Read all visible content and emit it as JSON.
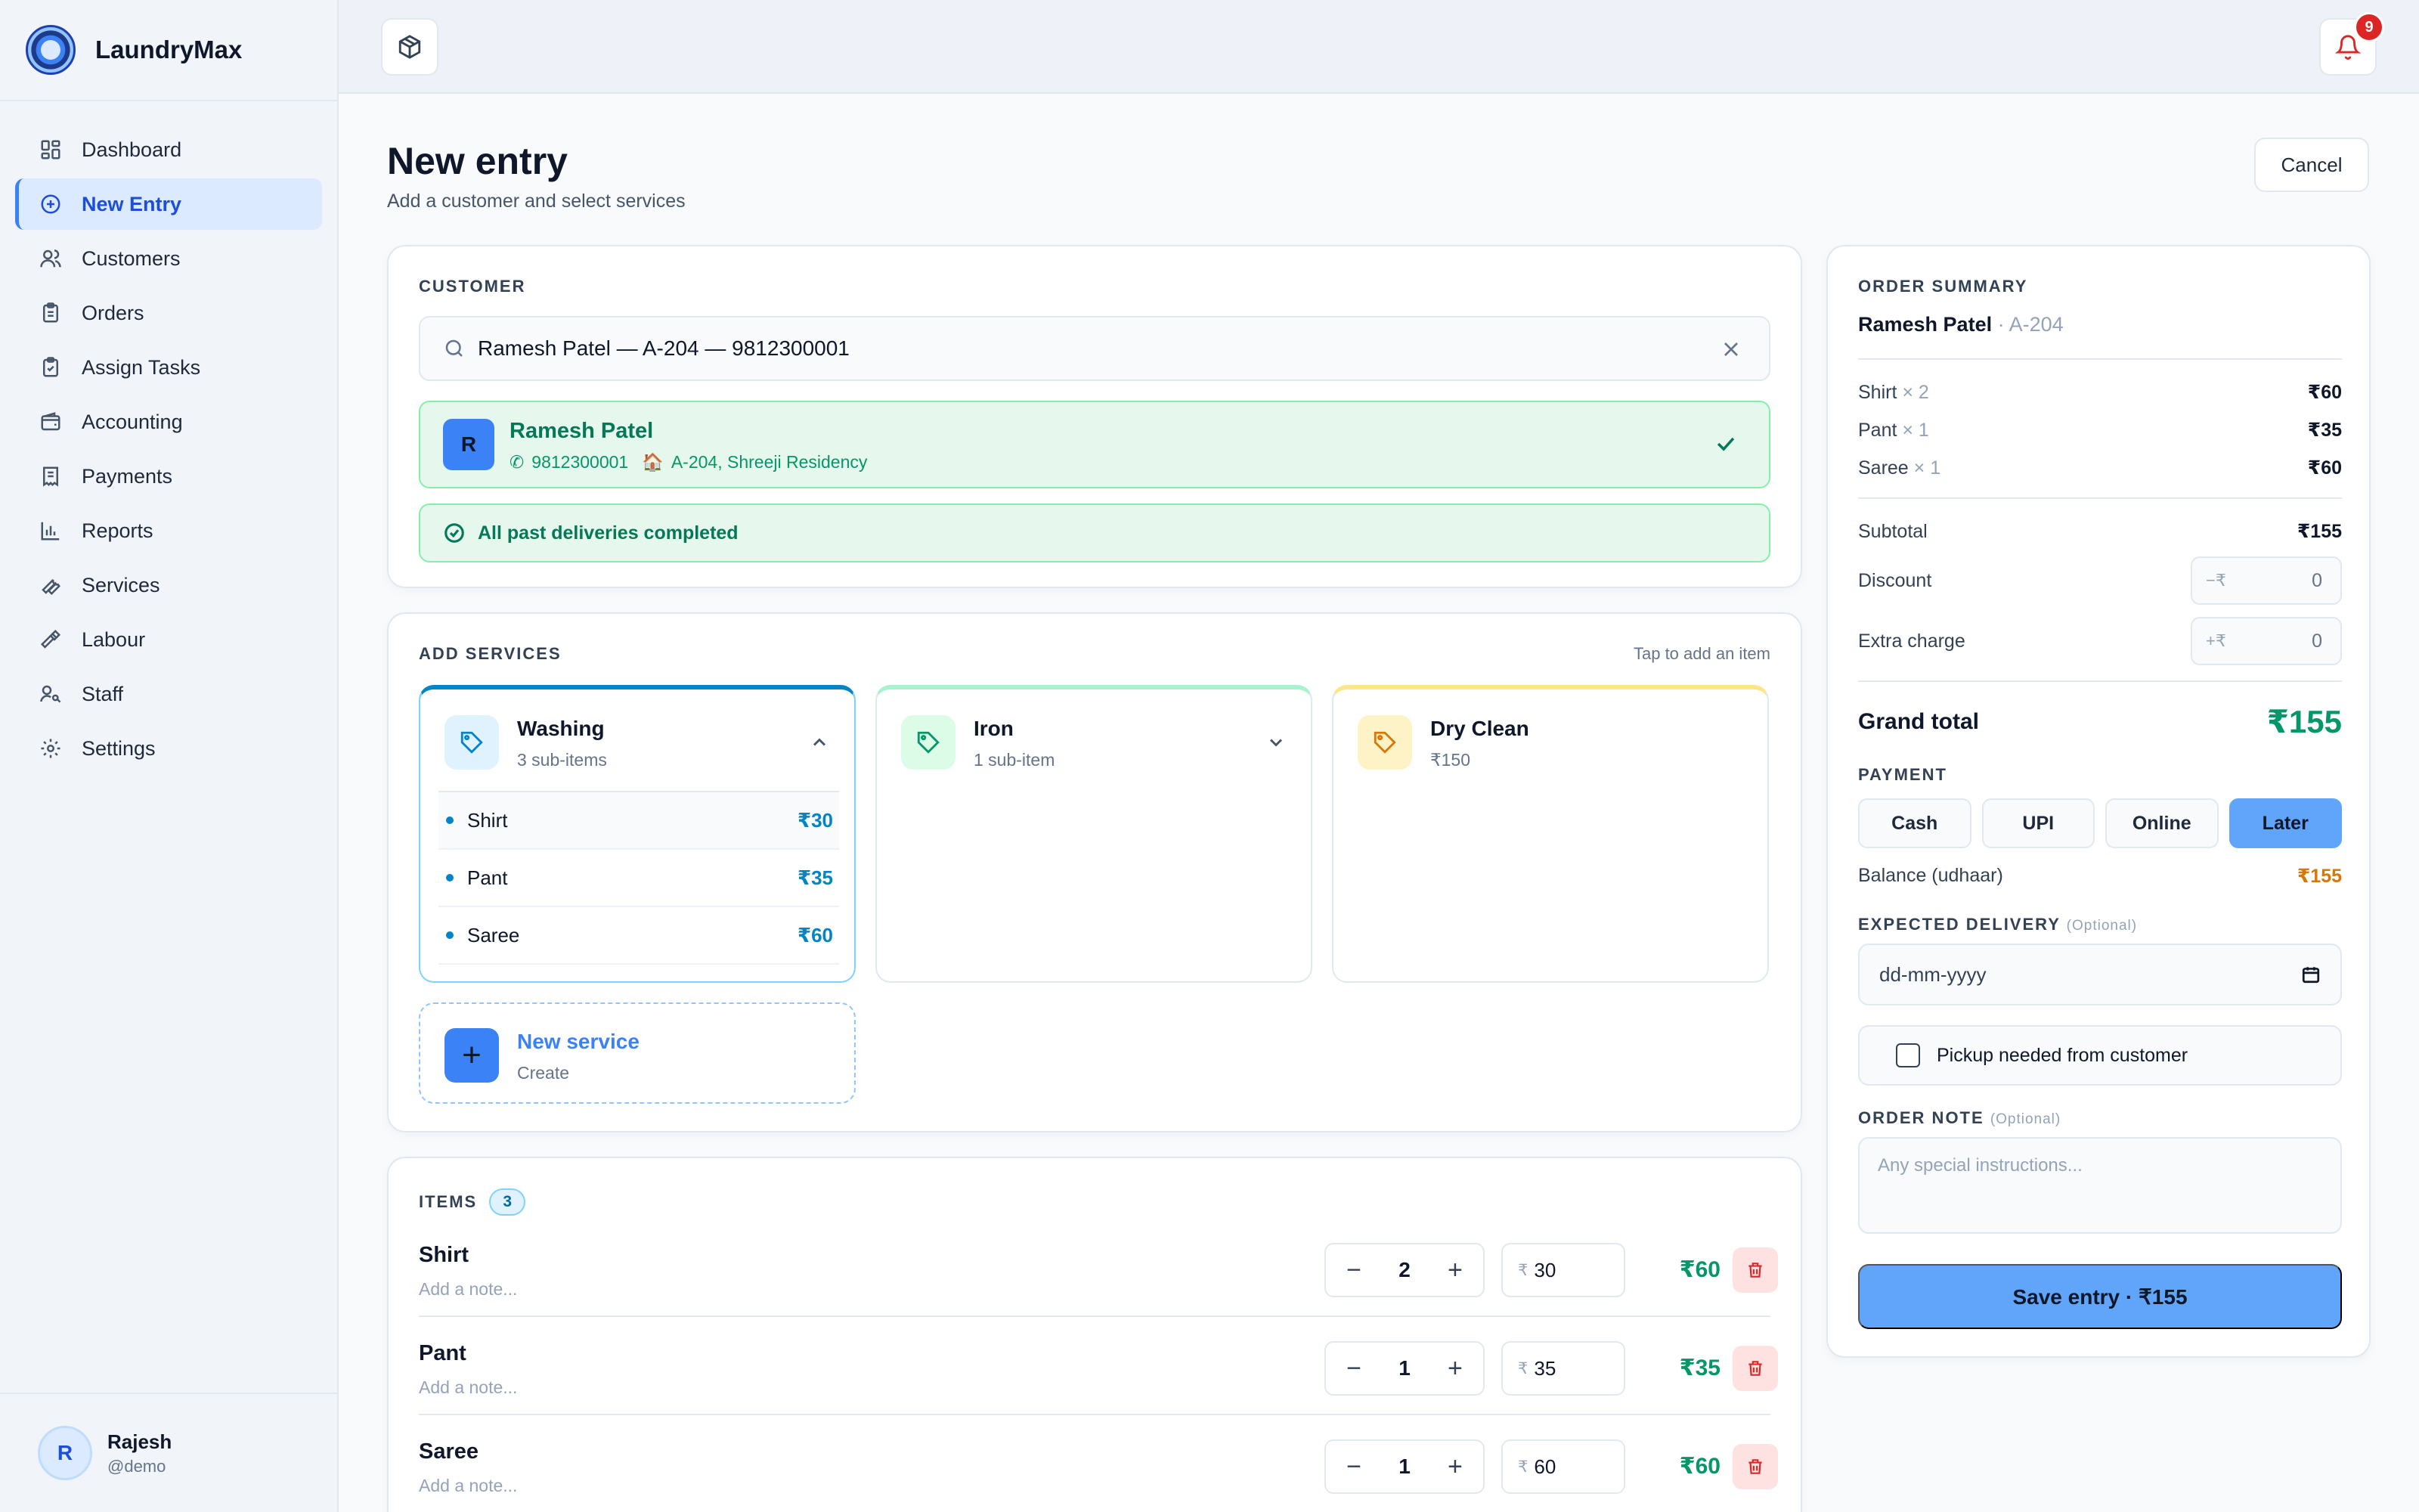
{
  "app": {
    "name": "LaundryMax"
  },
  "sidebar": {
    "items": [
      {
        "label": "Dashboard",
        "icon": "dashboard-icon"
      },
      {
        "label": "New Entry",
        "icon": "plus-circle-icon",
        "active": true
      },
      {
        "label": "Customers",
        "icon": "users-icon"
      },
      {
        "label": "Orders",
        "icon": "clipboard-icon"
      },
      {
        "label": "Assign Tasks",
        "icon": "clipboard-check-icon"
      },
      {
        "label": "Accounting",
        "icon": "wallet-icon"
      },
      {
        "label": "Payments",
        "icon": "receipt-icon"
      },
      {
        "label": "Reports",
        "icon": "bar-chart-icon"
      },
      {
        "label": "Services",
        "icon": "wrench-icon"
      },
      {
        "label": "Labour",
        "icon": "hammer-icon"
      },
      {
        "label": "Staff",
        "icon": "user-key-icon"
      },
      {
        "label": "Settings",
        "icon": "gear-icon"
      }
    ],
    "user": {
      "initial": "R",
      "name": "Rajesh",
      "handle": "@demo"
    }
  },
  "topbar": {
    "notification_count": "9"
  },
  "header": {
    "title": "New entry",
    "subtitle": "Add a customer and select services",
    "cancel_label": "Cancel"
  },
  "customer": {
    "section_label": "CUSTOMER",
    "search_value": "Ramesh Patel — A-204 — 9812300001",
    "selected": {
      "initial": "R",
      "name": "Ramesh Patel",
      "phone": "9812300001",
      "address": "A-204, Shreeji Residency"
    },
    "status": "All past deliveries completed"
  },
  "services": {
    "section_label": "ADD SERVICES",
    "hint": "Tap to add an item",
    "cards": [
      {
        "name": "Washing",
        "sub": "3 sub-items",
        "color": "#0284c7",
        "items": [
          {
            "name": "Shirt",
            "price": "₹30"
          },
          {
            "name": "Pant",
            "price": "₹35"
          },
          {
            "name": "Saree",
            "price": "₹60"
          }
        ]
      },
      {
        "name": "Iron",
        "sub": "1 sub-item",
        "color": "#059669"
      },
      {
        "name": "Dry Clean",
        "sub": "₹150",
        "color": "#d97706"
      }
    ],
    "new_service": {
      "name": "New service",
      "sub": "Create",
      "plus": "+"
    }
  },
  "items": {
    "section_label": "ITEMS",
    "count": "3",
    "rows": [
      {
        "name": "Shirt",
        "note_placeholder": "Add a note...",
        "qty": "2",
        "currency": "₹",
        "price": "30",
        "total": "₹60"
      },
      {
        "name": "Pant",
        "note_placeholder": "Add a note...",
        "qty": "1",
        "currency": "₹",
        "price": "35",
        "total": "₹35"
      },
      {
        "name": "Saree",
        "note_placeholder": "Add a note...",
        "qty": "1",
        "currency": "₹",
        "price": "60",
        "total": "₹60"
      }
    ],
    "minus": "−",
    "plus": "+"
  },
  "summary": {
    "section_label": "ORDER SUMMARY",
    "customer_name": "Ramesh Patel",
    "customer_unit": "· A-204",
    "lines": [
      {
        "name": "Shirt",
        "qty": "× 2",
        "amount": "₹60"
      },
      {
        "name": "Pant",
        "qty": "× 1",
        "amount": "₹35"
      },
      {
        "name": "Saree",
        "qty": "× 1",
        "amount": "₹60"
      }
    ],
    "subtotal_label": "Subtotal",
    "subtotal": "₹155",
    "discount_label": "Discount",
    "discount_prefix": "−₹",
    "discount_value": "0",
    "extra_label": "Extra charge",
    "extra_prefix": "+₹",
    "extra_value": "0",
    "grand_label": "Grand total",
    "grand_total": "₹155",
    "payment_label": "PAYMENT",
    "payment_options": [
      "Cash",
      "UPI",
      "Online",
      "Later"
    ],
    "payment_selected": "Later",
    "balance_label": "Balance (udhaar)",
    "balance": "₹155",
    "delivery_label": "EXPECTED DELIVERY",
    "optional": "(Optional)",
    "delivery_placeholder": "dd-mm-yyyy",
    "pickup_label": "Pickup needed from customer",
    "note_label": "ORDER NOTE",
    "note_placeholder": "Any special instructions...",
    "save_label": "Save entry · ₹155"
  }
}
